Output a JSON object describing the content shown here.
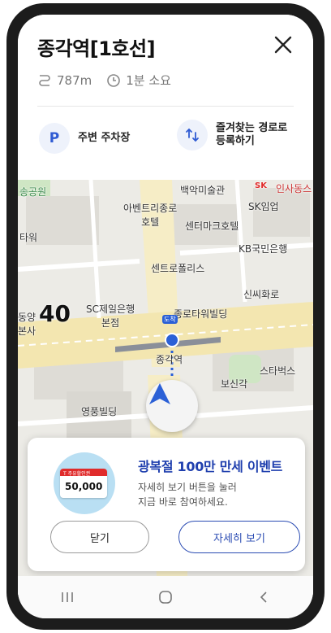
{
  "header": {
    "title": "종각역[1호선]",
    "distance": "787m",
    "duration": "1분 소요"
  },
  "actions": [
    {
      "label": "주변 주차장",
      "icon": "parking-icon"
    },
    {
      "label": "즐겨찾는 경로로\n등록하기",
      "icon": "route-swap-icon"
    }
  ],
  "map": {
    "speed_limit": "40",
    "labels": {
      "park": "송공원",
      "art_hall": "백악미술관",
      "sk_brand": "SK",
      "insa": "인사동스",
      "avenue_hotel": "아벤트리종로\n호텔",
      "sk_company": "SK임업",
      "center_mark": "센터마크호텔",
      "tower": "타워",
      "kb_bank": "KB국민은행",
      "centropolis": "센트로폴리스",
      "shinshin": "신씨화로",
      "sc_bank": "SC제일은행\n본점",
      "dongyang": "동양\n본사",
      "jongro_tower": "종로타워빌딩",
      "destination_tag": "도착",
      "jonggak_station": "종각역",
      "starbucks": "스타벅스",
      "bosingak": "보신각",
      "youngpoong": "영풍빌딩"
    }
  },
  "promo": {
    "title": "광복절 100만 만세 이벤트",
    "description": "자세히 보기 버튼을 눌러\n지금 바로 참여하세요.",
    "card_brand": "T 주유할인권",
    "card_amount": "50,000",
    "close_label": "닫기",
    "detail_label": "자세히 보기"
  },
  "colors": {
    "accent": "#2f5bd3",
    "brand_blue": "#1f3fae",
    "route_blue": "#2b60d6",
    "sk_red": "#e02b2b"
  }
}
